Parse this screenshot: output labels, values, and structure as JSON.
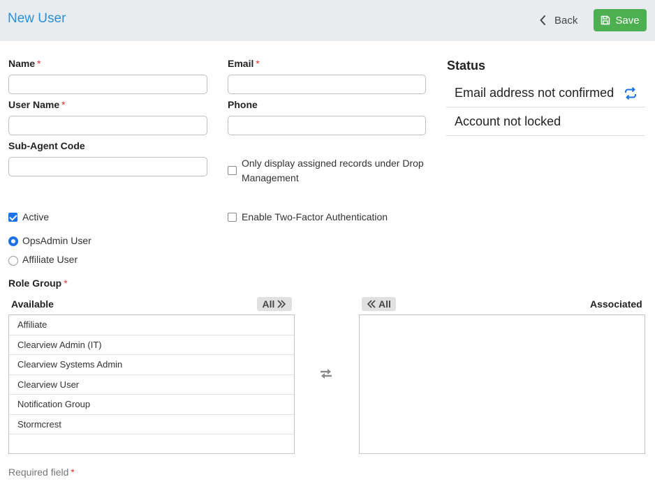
{
  "header": {
    "title": "New User",
    "back_label": "Back",
    "save_label": "Save"
  },
  "form": {
    "name_label": "Name",
    "email_label": "Email",
    "username_label": "User Name",
    "phone_label": "Phone",
    "subagent_label": "Sub-Agent Code",
    "required_mark": "*",
    "drop_mgmt_line1": "Only display assigned records under Drop",
    "drop_mgmt_line2": "Management",
    "active_label": "Active",
    "twofa_label": "Enable Two-Factor Authentication",
    "opsadmin_label": "OpsAdmin User",
    "affiliate_label": "Affiliate User",
    "role_group_label": "Role Group"
  },
  "status": {
    "title": "Status",
    "email_status": "Email address not confirmed",
    "lock_status": "Account not locked"
  },
  "roles": {
    "available_label": "Available",
    "associated_label": "Associated",
    "all_label": "All",
    "available_items": [
      "Affiliate",
      "Clearview Admin (IT)",
      "Clearview Systems Admin",
      "Clearview User",
      "Notification Group",
      "Stormcrest"
    ]
  },
  "footer": {
    "required_note": "Required field"
  },
  "colors": {
    "accent": "#2b8fd6",
    "save": "#4caf50",
    "check": "#1a73e8",
    "required": "#dd3333"
  },
  "icons": {
    "back": "chevron-left-icon",
    "save": "floppy-disk-icon",
    "refresh": "refresh-icon",
    "add_all": "double-chevron-right-icon",
    "remove_all": "double-chevron-left-icon",
    "swap": "swap-arrows-icon"
  }
}
